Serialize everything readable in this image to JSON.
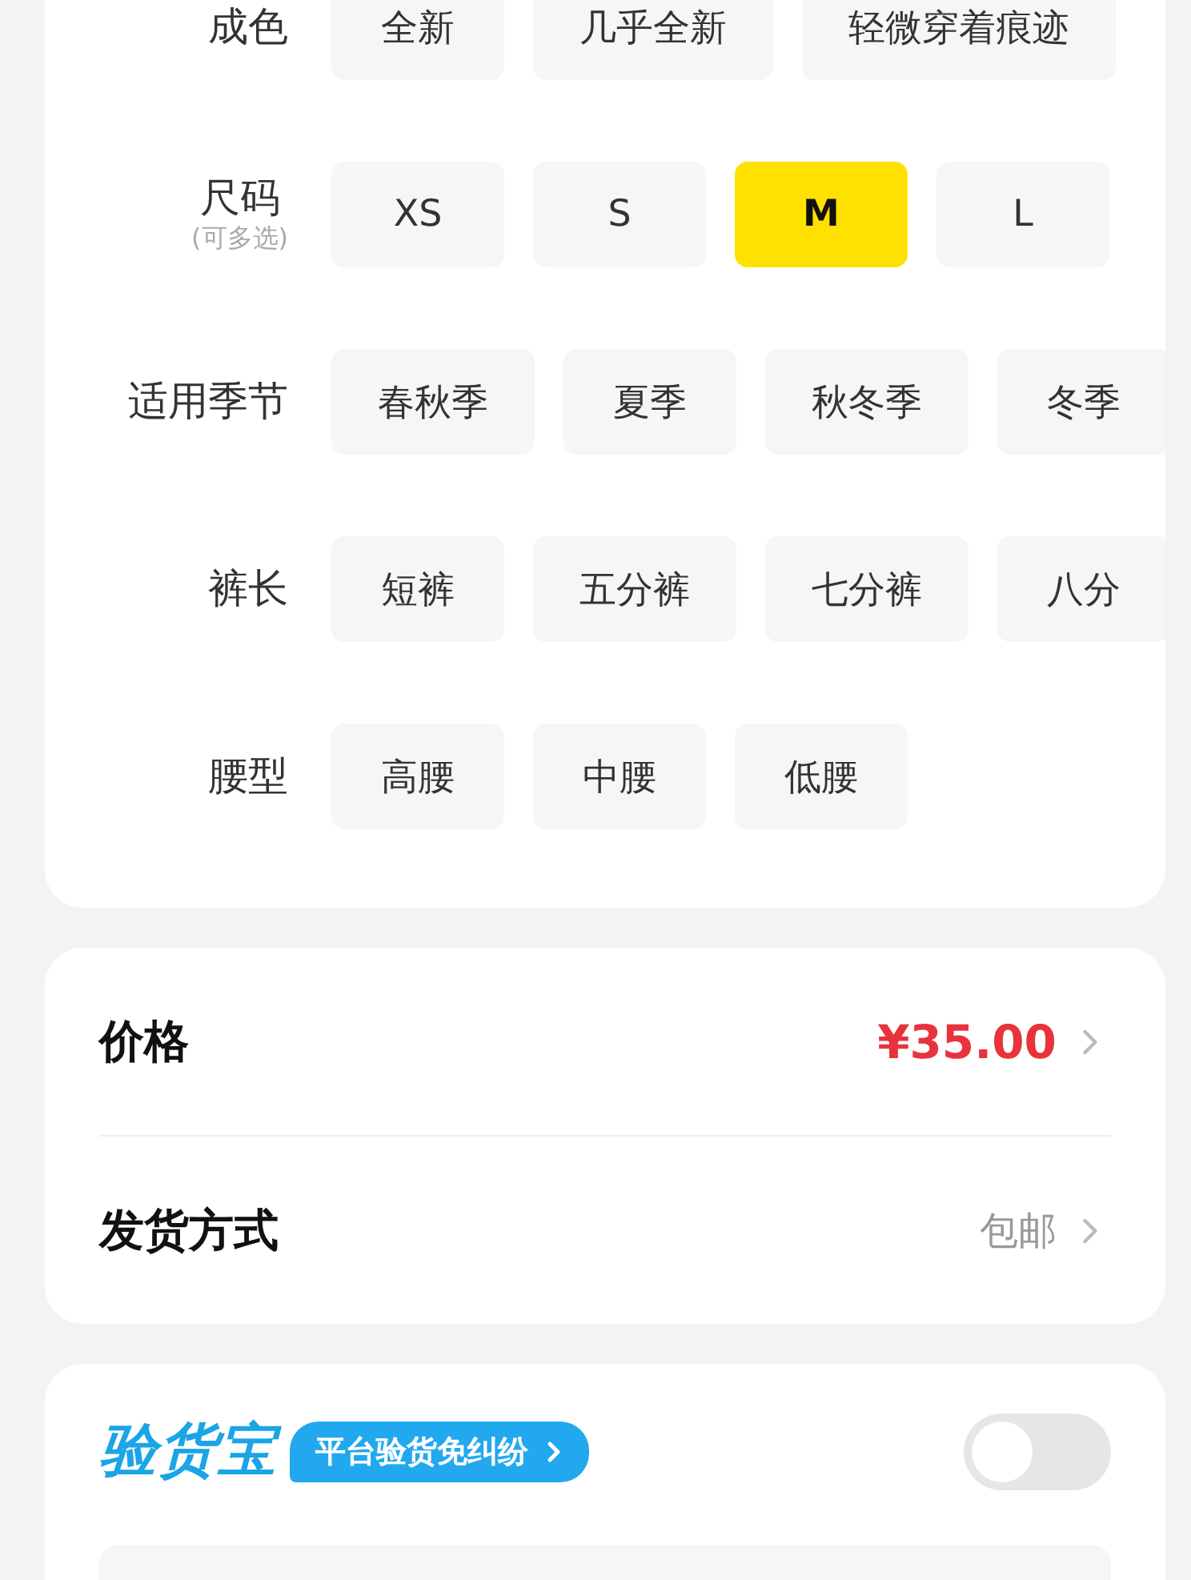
{
  "attributes": [
    {
      "label": "成色",
      "options": [
        {
          "label": "全新",
          "selected": false
        },
        {
          "label": "几乎全新",
          "selected": false
        },
        {
          "label": "轻微穿着痕迹",
          "selected": false
        }
      ]
    },
    {
      "label": "尺码",
      "hint": "(可多选)",
      "options": [
        {
          "label": "XS",
          "selected": false
        },
        {
          "label": "S",
          "selected": false
        },
        {
          "label": "M",
          "selected": true
        },
        {
          "label": "L",
          "selected": false
        }
      ]
    },
    {
      "label": "适用季节",
      "options": [
        {
          "label": "春秋季",
          "selected": false
        },
        {
          "label": "夏季",
          "selected": false
        },
        {
          "label": "秋冬季",
          "selected": false
        },
        {
          "label": "冬季",
          "selected": false
        }
      ]
    },
    {
      "label": "裤长",
      "options": [
        {
          "label": "短裤",
          "selected": false
        },
        {
          "label": "五分裤",
          "selected": false
        },
        {
          "label": "七分裤",
          "selected": false
        },
        {
          "label": "八分",
          "selected": false
        }
      ]
    },
    {
      "label": "腰型",
      "options": [
        {
          "label": "高腰",
          "selected": false
        },
        {
          "label": "中腰",
          "selected": false
        },
        {
          "label": "低腰",
          "selected": false
        }
      ]
    }
  ],
  "details": [
    {
      "label": "价格",
      "value": "¥35.00",
      "kind": "price"
    },
    {
      "label": "发货方式",
      "value": "包邮",
      "kind": "plain"
    }
  ],
  "inspection": {
    "logo": "验货宝",
    "badge": "平台验货免纠纷",
    "on": false
  }
}
